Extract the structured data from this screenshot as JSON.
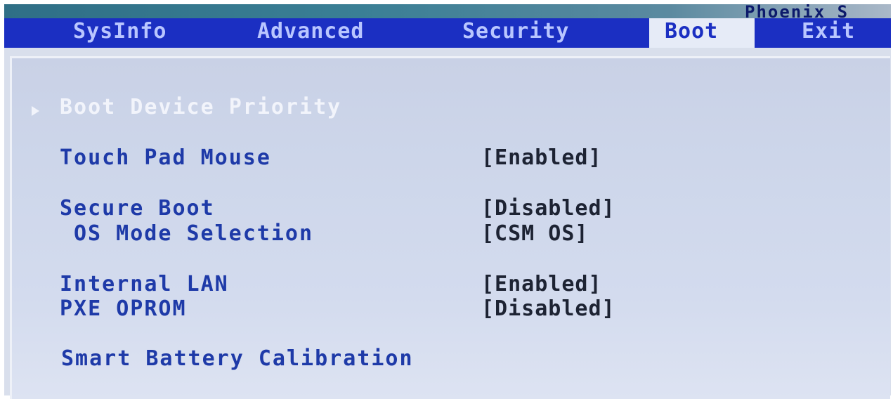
{
  "vendor": "Phoenix S",
  "menu": {
    "tabs": [
      {
        "label": "SysInfo"
      },
      {
        "label": "Advanced"
      },
      {
        "label": "Security"
      },
      {
        "label": "Boot"
      },
      {
        "label": "Exit"
      }
    ],
    "active": "Boot"
  },
  "boot": {
    "submenu": {
      "label": "Boot Device Priority",
      "icon": "triangle-right-icon"
    },
    "items": [
      {
        "label": "Touch Pad Mouse",
        "value": "[Enabled]"
      },
      {
        "label": "Secure Boot",
        "value": "[Disabled]"
      },
      {
        "label": "OS Mode Selection",
        "value": "[CSM OS]"
      },
      {
        "label": "Internal LAN",
        "value": "[Enabled]"
      },
      {
        "label": "PXE OPROM",
        "value": "[Disabled]"
      },
      {
        "label": "Smart Battery Calibration"
      }
    ]
  },
  "colors": {
    "menu_bar": "#1b2fc2",
    "menu_text": "#b9c6ff",
    "active_tab_bg": "#e6ebf7",
    "panel_bg": "#cdd6ea",
    "item_text": "#1e3aa8",
    "value_text": "#1d2333",
    "header_text": "#f2f4fb"
  }
}
